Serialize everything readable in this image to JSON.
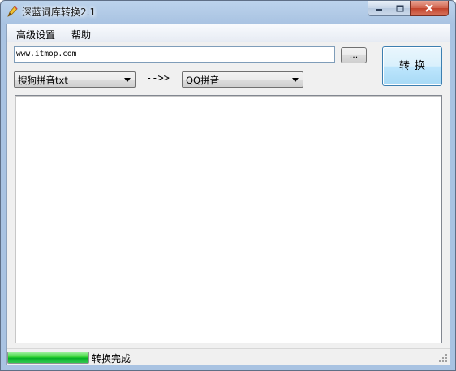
{
  "window": {
    "title": "深蓝词库转换2.1"
  },
  "menu": {
    "advanced_settings": "高级设置",
    "help": "帮助"
  },
  "path_input": {
    "value": "www.itmop.com"
  },
  "browse_button": {
    "label": "..."
  },
  "convert_button": {
    "label": "转换"
  },
  "source_format": {
    "selected": "搜狗拼音txt"
  },
  "arrow": {
    "label": "-->>"
  },
  "target_format": {
    "selected": "QQ拼音"
  },
  "output": {
    "content": ""
  },
  "status": {
    "text": "转换完成",
    "progress": 1.0,
    "progress_color": "#06b025"
  },
  "icons": [
    "pen-app-icon",
    "minimize-icon",
    "maximize-icon",
    "close-icon",
    "dropdown-arrow-icon",
    "resize-grip-icon"
  ]
}
